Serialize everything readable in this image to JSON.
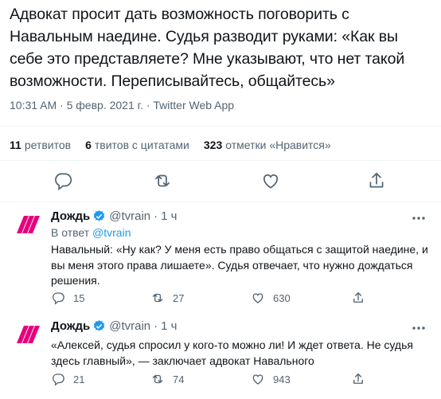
{
  "main_tweet": {
    "text": "Адвокат просит дать возможность поговорить с Навальным наедине. Судья разводит руками: «Как вы себе это представляете? Мне указывают, что нет такой возможности. Переписывайтесь, общайтесь»",
    "time": "10:31 AM",
    "separator": "·",
    "date": "5 февр. 2021 г.",
    "source": "Twitter Web App"
  },
  "stats": {
    "retweets_count": "11",
    "retweets_label": "ретвитов",
    "quotes_count": "6",
    "quotes_label": "твитов с цитатами",
    "likes_count": "323",
    "likes_label": "отметки «Нравится»"
  },
  "replies": [
    {
      "name": "Дождь",
      "handle": "@tvrain",
      "separator": "·",
      "time": "1 ч",
      "reply_to_prefix": "В ответ",
      "reply_to_handle": "@tvrain",
      "text": "Навальный: «Ну как? У меня есть право общаться с защитой наедине, и вы меня этого права лишаете». Судья отвечает, что нужно дождаться решения.",
      "reply_count": "15",
      "retweet_count": "27",
      "like_count": "630"
    },
    {
      "name": "Дождь",
      "handle": "@tvrain",
      "separator": "·",
      "time": "1 ч",
      "text": "«Алексей, судья спросил у кого-то можно ли! И ждет ответа. Не судья здесь главный», — заключает адвокат Навального",
      "reply_count": "21",
      "retweet_count": "74",
      "like_count": "943"
    }
  ],
  "colors": {
    "text": "#0f1419",
    "secondary": "#536471",
    "link": "#1d9bf0",
    "divider": "#eff3f4",
    "brand_pink": "#e6007e"
  },
  "icons": [
    "reply-icon",
    "retweet-icon",
    "like-icon",
    "share-icon",
    "verified-icon",
    "more-icon",
    "tvrain-logo"
  ]
}
